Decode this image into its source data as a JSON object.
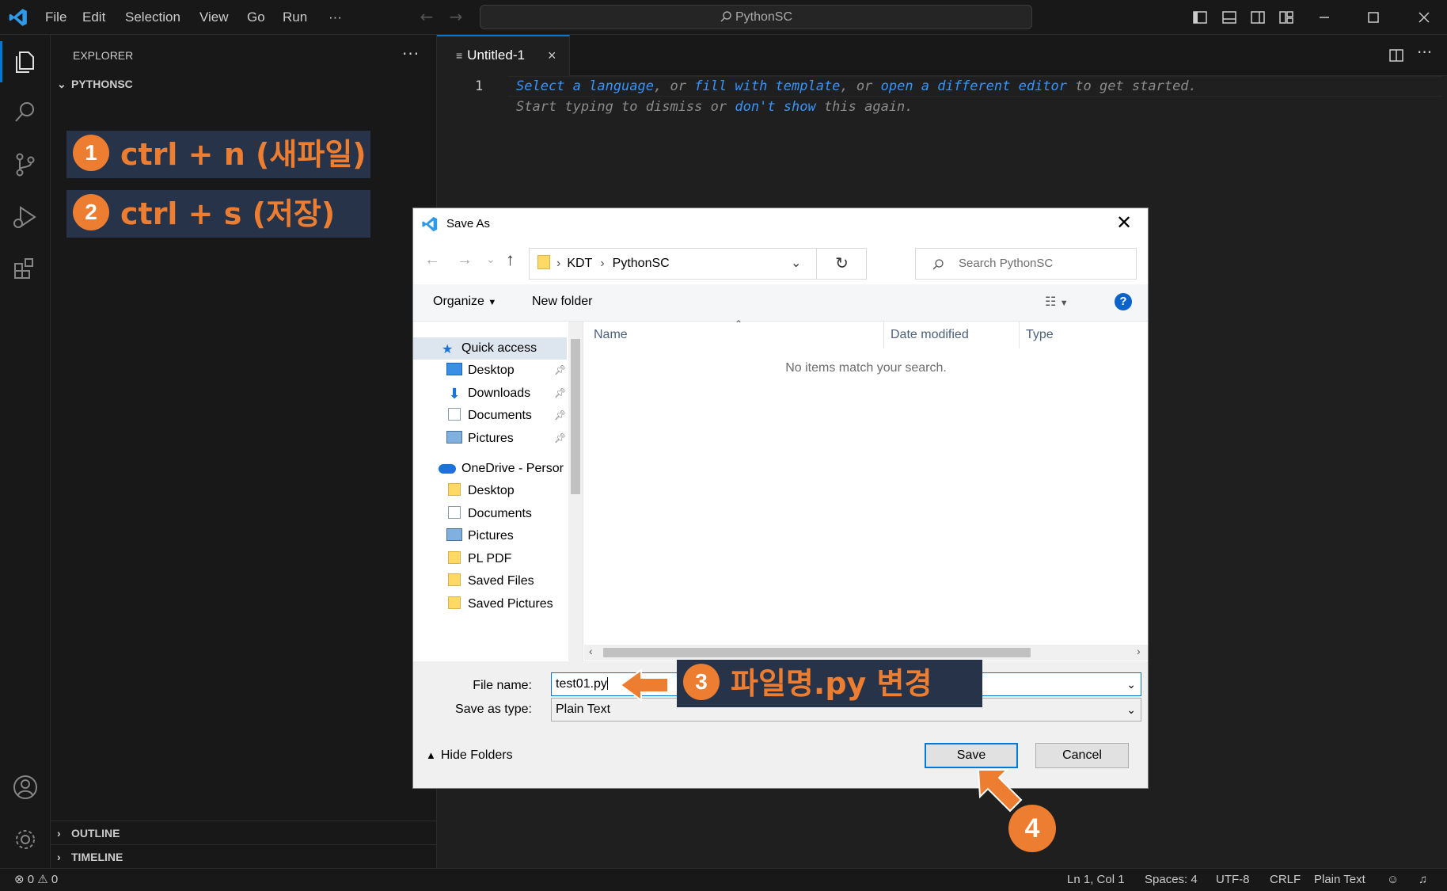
{
  "titlebar": {
    "menus": [
      "File",
      "Edit",
      "Selection",
      "View",
      "Go",
      "Run",
      "···"
    ],
    "search": "PythonSC"
  },
  "sidebar": {
    "title": "EXPLORER",
    "more": "···",
    "folder": "PYTHONSC",
    "outline": "OUTLINE",
    "timeline": "TIMELINE"
  },
  "annotations": {
    "step1_num": "1",
    "step1_text": "ctrl + n (새파일)",
    "step2_num": "2",
    "step2_text": "ctrl + s (저장)",
    "step3_num": "3",
    "step3_text": "파일명.py 변경",
    "step4_num": "4",
    "accent_color": "#ed7d31",
    "note_bg": "#263348"
  },
  "editor": {
    "tab_label": "Untitled-1",
    "tab_close": "×",
    "line_number": "1",
    "hint_line1": {
      "link1": "Select a language",
      "sep1": ", or ",
      "link2": "fill with template",
      "sep2": ", or ",
      "link3": "open a different editor",
      "tail": " to get started."
    },
    "hint_line2": {
      "head": "Start typing to dismiss or ",
      "link": "don't show",
      "tail": " this again."
    }
  },
  "dialog": {
    "title": "Save As",
    "path_segments": [
      "KDT",
      "PythonSC"
    ],
    "search_placeholder": "Search PythonSC",
    "organize": "Organize",
    "new_folder": "New folder",
    "nav_items": [
      {
        "label": "Quick access",
        "icon": "star-icon"
      },
      {
        "label": "Desktop",
        "icon": "desktop-icon"
      },
      {
        "label": "Downloads",
        "icon": "download-icon"
      },
      {
        "label": "Documents",
        "icon": "document-icon"
      },
      {
        "label": "Pictures",
        "icon": "pictures-icon"
      },
      {
        "label": "OneDrive - Persor",
        "icon": "cloud-icon"
      },
      {
        "label": "Desktop",
        "icon": "folder-icon"
      },
      {
        "label": "Documents",
        "icon": "document-icon"
      },
      {
        "label": "Pictures",
        "icon": "pictures-icon"
      },
      {
        "label": "PL PDF",
        "icon": "folder-icon"
      },
      {
        "label": "Saved Files",
        "icon": "folder-icon"
      },
      {
        "label": "Saved Pictures",
        "icon": "folder-icon"
      }
    ],
    "columns": [
      "Name",
      "Date modified",
      "Type"
    ],
    "empty_message": "No items match your search.",
    "file_name_label": "File name:",
    "file_name_value": "test01.py",
    "save_type_label": "Save as type:",
    "save_type_value": "Plain Text",
    "hide_folders": "Hide Folders",
    "save_button": "Save",
    "cancel_button": "Cancel"
  },
  "statusbar": {
    "errors": "0",
    "warnings": "0",
    "position": "Ln 1, Col 1",
    "spaces": "Spaces: 4",
    "encoding": "UTF-8",
    "eol": "CRLF",
    "language": "Plain Text"
  }
}
